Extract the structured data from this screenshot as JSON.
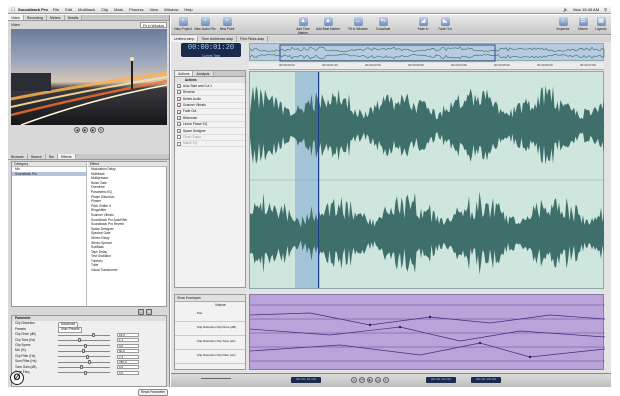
{
  "menubar": {
    "app_name": "Soundtrack Pro",
    "items": [
      "File",
      "Edit",
      "Multitrack",
      "Clip",
      "Mark",
      "Process",
      "View",
      "Window",
      "Help"
    ],
    "clock": "Mon 15:40 AM"
  },
  "left": {
    "top_tabs": [
      "Video",
      "Recording",
      "Meters",
      "Details"
    ],
    "video_title": "Video",
    "video_fit": "Fit in Window",
    "lower_tabs": [
      "Browser",
      "Search",
      "Bin",
      "Effects"
    ],
    "category_header": "Category",
    "categories": [
      "Mix",
      "Soundtrack Pro"
    ],
    "effect_header": "Effect",
    "effects": [
      "Modulation Delay",
      "Multitrack",
      "Multipressor",
      "Noise Gate",
      "Overdrive",
      "Parametric EQ",
      "Phase Distortion",
      "Phaser",
      "Pitch Shifter II",
      "Ringshifter",
      "Scanner Vibrato",
      "Soundtrack Pro AutoFilter",
      "Soundtrack Pro Reverb",
      "Space Designer",
      "Spectral Gate",
      "Stereo Delay",
      "Stereo Spread",
      "SubBass",
      "Tape Delay",
      "Test Oscillator",
      "Tremolo",
      "Tube",
      "Visual Transformer"
    ],
    "param_header": "Parameter",
    "param_rows": [
      {
        "label": "Clip Distortion",
        "value": ""
      },
      {
        "label": "Presets",
        "value": "User Presets"
      },
      {
        "label": "Clip Drive (dB)",
        "value": "18.0"
      },
      {
        "label": "Clip Tone (Hz)",
        "value": "1.1"
      },
      {
        "label": "Clip Symm",
        "value": "0.0"
      },
      {
        "label": "Mix (%)",
        "value": "50.0"
      },
      {
        "label": "Clip Filter (Hz)",
        "value": "7.3"
      },
      {
        "label": "Sum Filter (Hz)",
        "value": "780.0"
      },
      {
        "label": "Tone Gain (dB)",
        "value": "0.0"
      },
      {
        "label": "Tone Freq",
        "value": "0.0"
      }
    ],
    "advanced_label": "Advanced",
    "reset_label": "Reset Parameter"
  },
  "toolbar": {
    "tools": [
      "New Project",
      "New Audio File",
      "New Point",
      "Add Time Marker",
      "Add Beat Marker",
      "Fit to Window",
      "Crossfade",
      "Fade In",
      "Fade Out",
      "Inspector",
      "Mixers",
      "Layouts"
    ]
  },
  "doc_tabs": [
    "Untitled.stmp",
    "Time Ambience.stap",
    "Film Flicks.stap"
  ],
  "timecode": {
    "main": "00:00:01:20",
    "sub": "Current Time"
  },
  "ruler_ticks": [
    "00:00:00:00",
    "00:00:01:00",
    "00:00:02:00",
    "00:00:03:00",
    "00:00:04:00",
    "00:00:05:00",
    "00:00:06:00",
    "00:00:07:00"
  ],
  "actions": {
    "header": "Actions",
    "tabs": [
      "Actions",
      "Analysis"
    ],
    "items": [
      {
        "label": "Auto Start and Cut 1",
        "checked": true,
        "dim": false
      },
      {
        "label": "Reverse",
        "checked": true,
        "dim": false
      },
      {
        "label": "Delete Audio",
        "checked": true,
        "dim": false
      },
      {
        "label": "Scanner Vibrato",
        "checked": true,
        "dim": false
      },
      {
        "label": "Fade Out",
        "checked": true,
        "dim": false
      },
      {
        "label": "Bitcrusher",
        "checked": true,
        "dim": false
      },
      {
        "label": "Linear Phase EQ",
        "checked": true,
        "dim": false
      },
      {
        "label": "Space Designer",
        "checked": true,
        "dim": false
      },
      {
        "label": "Clear Output",
        "checked": false,
        "dim": true
      },
      {
        "label": "Match EQ",
        "checked": false,
        "dim": true
      }
    ]
  },
  "envelopes": {
    "selector": "Show Envelopes",
    "volume_label": "Volume",
    "rows": [
      "Pan",
      "Clip Distortion Clip Drive (dB)",
      "Clip Distortion Clip Tone (Hz)",
      "Clip Distortion Clip Filter (Hz)"
    ]
  },
  "bottom": {
    "tc_left": "00:00:01:20",
    "tc_mid": "00:00:08:00",
    "tc_right": "00:00:00:00"
  },
  "logo": "Ø"
}
